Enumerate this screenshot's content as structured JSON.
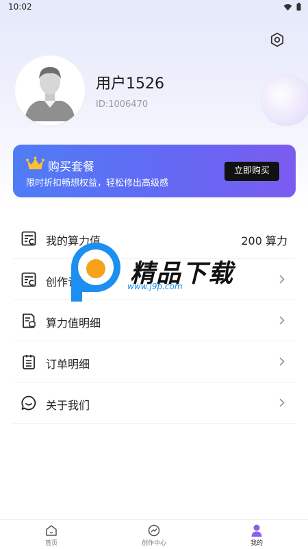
{
  "status_bar": {
    "time": "10:02"
  },
  "profile": {
    "username": "用户1526",
    "user_id": "ID:1006470"
  },
  "promo": {
    "title": "购买套餐",
    "subtitle": "限时折扣畅想权益，轻松修出高级感",
    "button_label": "立即购买"
  },
  "menu": {
    "items": [
      {
        "label": "我的算力值",
        "value": "200 算力",
        "icon": "compute-list-icon"
      },
      {
        "label": "创作记录",
        "icon": "creation-record-icon"
      },
      {
        "label": "算力值明细",
        "icon": "compute-detail-icon"
      },
      {
        "label": "订单明细",
        "icon": "clipboard-icon"
      },
      {
        "label": "关于我们",
        "icon": "chat-bubble-icon"
      }
    ]
  },
  "watermark": {
    "text": "精品下载",
    "url": "www.j9p.com"
  },
  "tabbar": {
    "tabs": [
      {
        "label": "首页",
        "icon": "home-icon"
      },
      {
        "label": "创作中心",
        "icon": "creation-center-icon"
      },
      {
        "label": "我的",
        "icon": "user-icon"
      }
    ],
    "active_index": 2
  },
  "colors": {
    "accent": "#5b6ef5",
    "active_tab": "#8a5cf0",
    "button": "#111111"
  }
}
